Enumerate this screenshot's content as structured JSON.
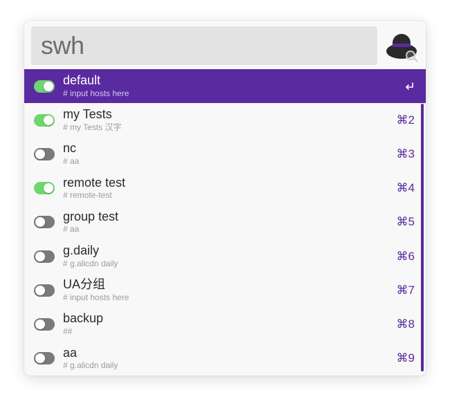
{
  "colors": {
    "accent": "#5a2aa0",
    "toggle_on": "#6fd66f",
    "toggle_off": "#7a7a7a"
  },
  "search": {
    "query": "swh"
  },
  "app_icon": {
    "name": "alfred-icon"
  },
  "return_glyph": "↩",
  "cmd_glyph": "⌘",
  "results": [
    {
      "title": "default",
      "subtitle": "# input hosts here",
      "enabled": true,
      "selected": true,
      "shortcut": ""
    },
    {
      "title": "my Tests",
      "subtitle": "# my Tests 汉字",
      "enabled": true,
      "selected": false,
      "shortcut": "⌘2"
    },
    {
      "title": "nc",
      "subtitle": "# aa",
      "enabled": false,
      "selected": false,
      "shortcut": "⌘3"
    },
    {
      "title": "remote test",
      "subtitle": "# remote-test",
      "enabled": true,
      "selected": false,
      "shortcut": "⌘4"
    },
    {
      "title": "group test",
      "subtitle": "# aa",
      "enabled": false,
      "selected": false,
      "shortcut": "⌘5"
    },
    {
      "title": "g.daily",
      "subtitle": "# g.alicdn daily",
      "enabled": false,
      "selected": false,
      "shortcut": "⌘6"
    },
    {
      "title": "UA分组",
      "subtitle": "# input hosts here",
      "enabled": false,
      "selected": false,
      "shortcut": "⌘7"
    },
    {
      "title": "backup",
      "subtitle": "##",
      "enabled": false,
      "selected": false,
      "shortcut": "⌘8"
    },
    {
      "title": "aa",
      "subtitle": "# g.alicdn daily",
      "enabled": false,
      "selected": false,
      "shortcut": "⌘9"
    }
  ]
}
